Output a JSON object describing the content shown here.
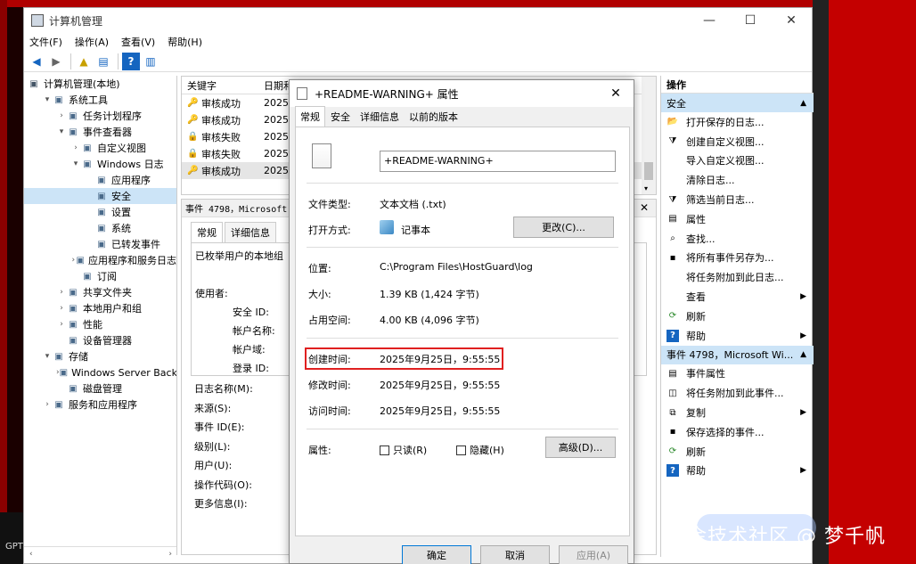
{
  "window": {
    "title": "计算机管理",
    "controls": [
      "—",
      "☐",
      "✕"
    ]
  },
  "menu": [
    "文件(F)",
    "操作(A)",
    "查看(V)",
    "帮助(H)"
  ],
  "tree": {
    "root": "计算机管理(本地)",
    "items": [
      {
        "label": "系统工具",
        "level": 1,
        "arrow": "▾"
      },
      {
        "label": "任务计划程序",
        "level": 2,
        "arrow": "›"
      },
      {
        "label": "事件查看器",
        "level": 2,
        "arrow": "▾"
      },
      {
        "label": "自定义视图",
        "level": 3,
        "arrow": "›"
      },
      {
        "label": "Windows 日志",
        "level": 3,
        "arrow": "▾"
      },
      {
        "label": "应用程序",
        "level": 4,
        "arrow": ""
      },
      {
        "label": "安全",
        "level": 4,
        "arrow": "",
        "selected": true
      },
      {
        "label": "设置",
        "level": 4,
        "arrow": ""
      },
      {
        "label": "系统",
        "level": 4,
        "arrow": ""
      },
      {
        "label": "已转发事件",
        "level": 4,
        "arrow": ""
      },
      {
        "label": "应用程序和服务日志",
        "level": 3,
        "arrow": "›"
      },
      {
        "label": "订阅",
        "level": 3,
        "arrow": ""
      },
      {
        "label": "共享文件夹",
        "level": 2,
        "arrow": "›"
      },
      {
        "label": "本地用户和组",
        "level": 2,
        "arrow": "›"
      },
      {
        "label": "性能",
        "level": 2,
        "arrow": "›"
      },
      {
        "label": "设备管理器",
        "level": 2,
        "arrow": ""
      },
      {
        "label": "存储",
        "level": 1,
        "arrow": "▾"
      },
      {
        "label": "Windows Server Back",
        "level": 2,
        "arrow": "›"
      },
      {
        "label": "磁盘管理",
        "level": 2,
        "arrow": ""
      },
      {
        "label": "服务和应用程序",
        "level": 1,
        "arrow": "›"
      }
    ]
  },
  "event_list": {
    "columns": [
      "关键字",
      "日期和"
    ],
    "rows": [
      {
        "keyword": "审核成功",
        "date": "2025/",
        "type": "success"
      },
      {
        "keyword": "审核成功",
        "date": "2025/",
        "type": "success"
      },
      {
        "keyword": "审核失败",
        "date": "2025/",
        "type": "failure"
      },
      {
        "keyword": "审核失败",
        "date": "2025/",
        "type": "failure"
      },
      {
        "keyword": "审核成功",
        "date": "2025/",
        "type": "success",
        "selected": true
      }
    ]
  },
  "event_detail": {
    "header": "事件 4798，Microsoft W",
    "tabs": [
      "常规",
      "详细信息"
    ],
    "desc_lines": [
      "已枚举用户的本地组",
      "",
      "使用者:"
    ],
    "subject_fields": [
      "安全 ID:",
      "帐户名称:",
      "帐户域:",
      "登录 ID:"
    ],
    "fields": [
      "日志名称(M):",
      "来源(S):",
      "事件 ID(E):",
      "级别(L):",
      "用户(U):",
      "操作代码(O):",
      "更多信息(I):"
    ]
  },
  "actions": {
    "title": "操作",
    "section1": "安全",
    "items1": [
      {
        "label": "打开保存的日志...",
        "icon": "folder-icon"
      },
      {
        "label": "创建自定义视图...",
        "icon": "filter-icon"
      },
      {
        "label": "导入自定义视图...",
        "icon": ""
      },
      {
        "label": "清除日志...",
        "icon": ""
      },
      {
        "label": "筛选当前日志...",
        "icon": "filter-icon"
      },
      {
        "label": "属性",
        "icon": "properties-icon"
      },
      {
        "label": "查找...",
        "icon": "find-icon"
      },
      {
        "label": "将所有事件另存为...",
        "icon": "save-icon"
      },
      {
        "label": "将任务附加到此日志...",
        "icon": ""
      },
      {
        "label": "查看",
        "icon": "",
        "submenu": true
      },
      {
        "label": "刷新",
        "icon": "refresh-icon"
      },
      {
        "label": "帮助",
        "icon": "help-icon",
        "submenu": true
      }
    ],
    "section2": "事件 4798，Microsoft Wi...",
    "items2": [
      {
        "label": "事件属性",
        "icon": "properties-icon"
      },
      {
        "label": "将任务附加到此事件...",
        "icon": "task-icon"
      },
      {
        "label": "复制",
        "icon": "copy-icon",
        "submenu": true
      },
      {
        "label": "保存选择的事件...",
        "icon": "save-icon"
      },
      {
        "label": "刷新",
        "icon": "refresh-icon"
      },
      {
        "label": "帮助",
        "icon": "help-icon",
        "submenu": true
      }
    ]
  },
  "dialog": {
    "title": "+README-WARNING+ 属性",
    "tabs": [
      "常规",
      "安全",
      "详细信息",
      "以前的版本"
    ],
    "filename": "+README-WARNING+",
    "file_type_label": "文件类型:",
    "file_type": "文本文档 (.txt)",
    "open_with_label": "打开方式:",
    "open_with": "记事本",
    "change_button": "更改(C)...",
    "location_label": "位置:",
    "location": "C:\\Program Files\\HostGuard\\log",
    "size_label": "大小:",
    "size": "1.39 KB (1,424 字节)",
    "disk_size_label": "占用空间:",
    "disk_size": "4.00 KB (4,096 字节)",
    "created_label": "创建时间:",
    "created": "2025年9月25日，9:55:55",
    "modified_label": "修改时间:",
    "modified": "2025年9月25日，9:55:55",
    "accessed_label": "访问时间:",
    "accessed": "2025年9月25日，9:55:55",
    "attributes_label": "属性:",
    "readonly": "只读(R)",
    "hidden": "隐藏(H)",
    "advanced_button": "高级(D)...",
    "ok": "确定",
    "cancel": "取消",
    "apply": "应用(A)"
  },
  "watermark": "掘金技术社区 @ 梦千帆",
  "taskbar_text": "GPT"
}
